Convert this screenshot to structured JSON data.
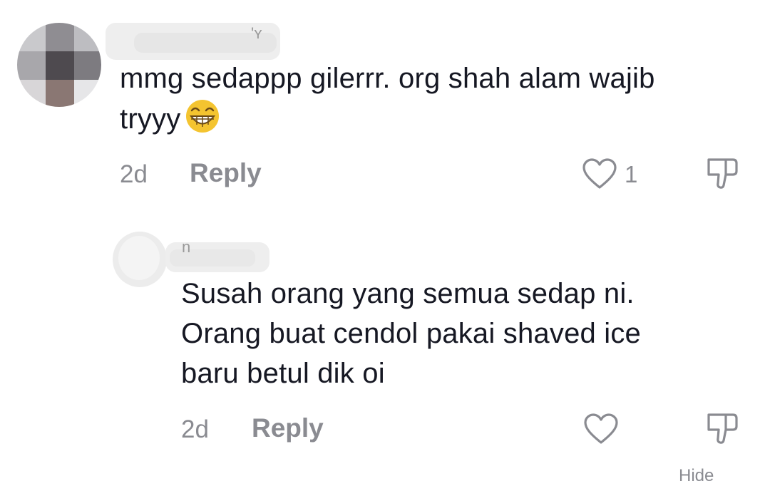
{
  "comments": [
    {
      "avatar": "pixelated-avatar",
      "username_partial": "'ʏ",
      "text_line1": "mmg sedappp gilerrr. org shah alam wajib",
      "text_line2": "tryyy",
      "emoji": "grinning-face-emoji",
      "time": "2d",
      "reply_label": "Reply",
      "like_count": "1"
    },
    {
      "avatar": "blurred-avatar",
      "username_partial": "n",
      "text_line1": "Susah orang yang semua sedap ni.",
      "text_line2": "Orang buat cendol pakai shaved ice",
      "text_line3": "baru betul dik oi",
      "time": "2d",
      "reply_label": "Reply"
    }
  ],
  "colors": {
    "text": "#161823",
    "muted": "#8a8b91",
    "background": "#ffffff"
  },
  "footer": {
    "hide_peek": "Hide"
  }
}
